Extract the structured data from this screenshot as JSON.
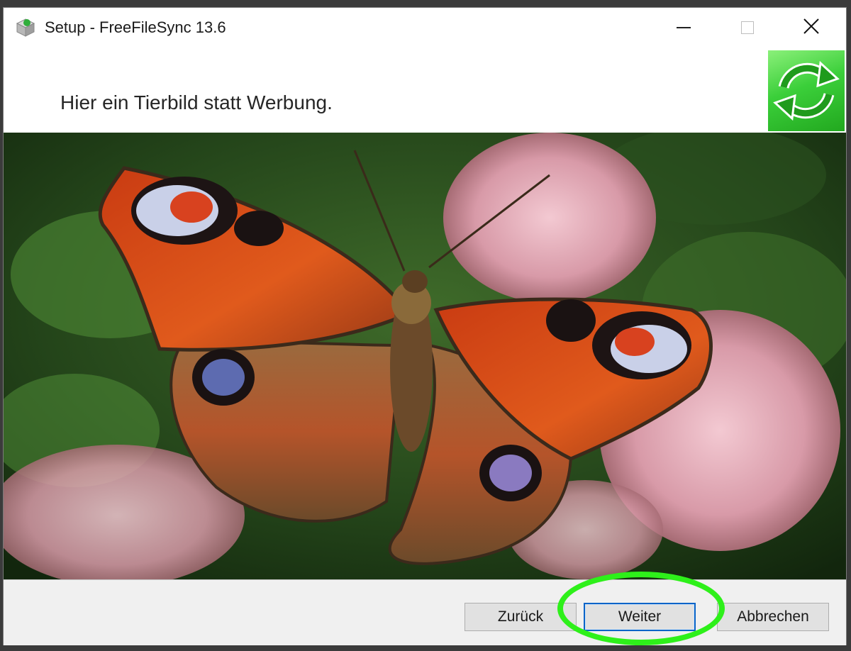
{
  "window": {
    "title": "Setup - FreeFileSync 13.6",
    "controls": {
      "minimize": "minimize-icon",
      "maximize": "maximize-icon",
      "close": "close-icon"
    }
  },
  "header": {
    "text": "Hier ein Tierbild statt Werbung.",
    "logo": "sync-arrows-icon"
  },
  "photo": {
    "subject": "butterfly-photo"
  },
  "buttons": {
    "back": "Zurück",
    "next": "Weiter",
    "cancel": "Abbrechen"
  },
  "colors": {
    "accent_focus": "#0a64c8",
    "highlight_ring": "#2ef01a",
    "logo_green": "#3bcf3a"
  }
}
